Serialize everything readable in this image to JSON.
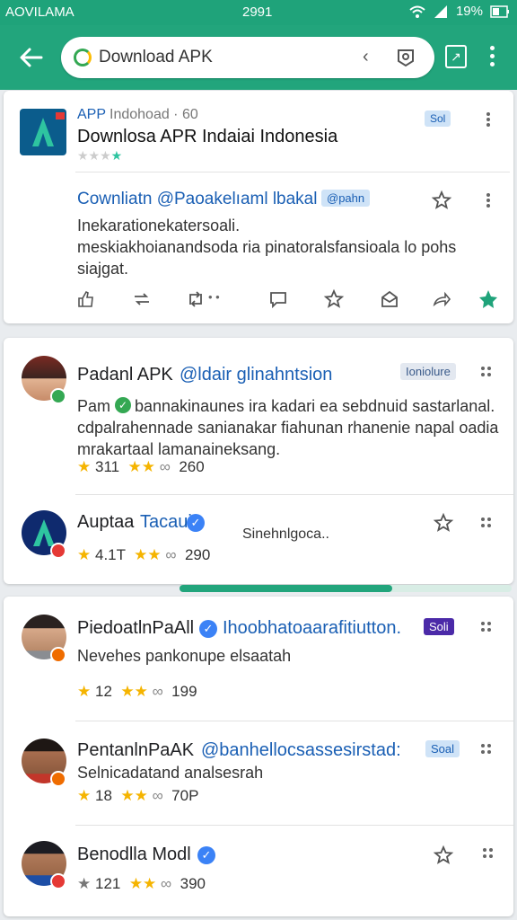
{
  "status_bar": {
    "carrier": "AOVILAMA",
    "time": "2991",
    "battery": "19%"
  },
  "search": {
    "value": "Download APK"
  },
  "featured": {
    "app_label": "APP",
    "app_meta": "Indohoad · 60",
    "title": "Downlosa APR Indaiai Indonesia",
    "tag": "Sol",
    "post": {
      "header": "Cownliatn @Paoakelıaml lbakal",
      "tag": "@pahn",
      "line1": "Inekarationekatersoali.",
      "line2": "meskiakhoianandsoda ria pinatoralsfansioala lo pohs",
      "line3": "siajgat."
    }
  },
  "card2": {
    "post1": {
      "name": "Padanl APK",
      "handle": "@ldair glinahntsion",
      "tag": "Ioniolure",
      "line1": "Pam",
      "line1b": "bannakinaunes ira kadari ea sebdnuid sastarlanal.",
      "line2": "cdpalrahennade sanianakar fiahunan rhanenie napal oadia",
      "line3": "mrakartaal lamanaineksang.",
      "stat1": "311",
      "stat2": "260"
    },
    "post2": {
      "name": "Auptaa",
      "handle": "Tacaui",
      "right_text": "Sinehnlgoca..",
      "stat1": "4.1T",
      "stat2": "290"
    }
  },
  "card3": {
    "post1": {
      "name": "PiedoatlnPaAll",
      "handle": "Ihoobhatoaarafitiutton.",
      "tag": "Soli",
      "body": "Nevehes pankonupe elsaatah",
      "stat1": "12",
      "stat2": "199"
    },
    "post2": {
      "name": "PentanlnPaAK",
      "handle": "@banhellocsassesirstad:",
      "tag": "Soal",
      "body": "Selnicadatand analsesrah",
      "stat1": "18",
      "stat2": "70P"
    },
    "post3": {
      "name": "Benodlla Modl",
      "stat1": "121",
      "stat2": "390"
    }
  },
  "progress": {
    "fraction": 0.64
  },
  "colors": {
    "brand": "#22a57c",
    "link": "#1a5fb4",
    "star": "#f5b400"
  }
}
